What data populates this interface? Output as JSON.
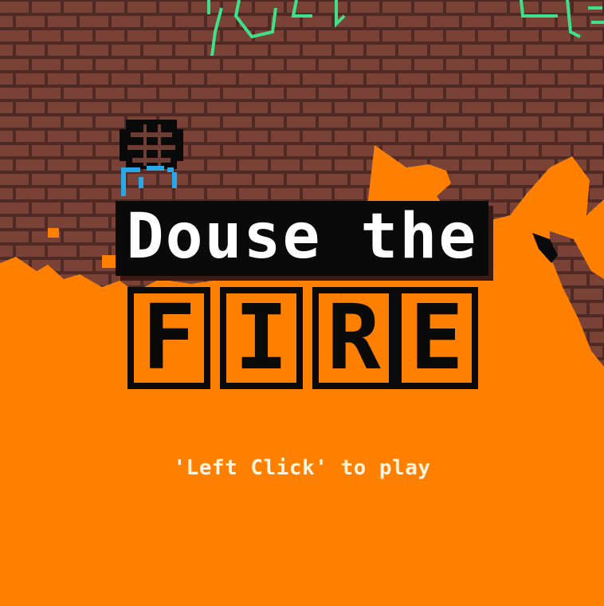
{
  "title": {
    "line1": "Douse the",
    "line2": [
      "F",
      "I",
      "R",
      "E"
    ]
  },
  "prompt": "'Left Click' to play",
  "colors": {
    "brick": "#7a4236",
    "mortar": "#4f2a24",
    "fire": "#ff8000",
    "title_fill": "#ffffff",
    "outline": "#0a0a0a",
    "water": "#29a8e8",
    "graffiti": "#3ee08a"
  },
  "icons": [
    "sewer-grate-icon",
    "water-drip-icon"
  ]
}
